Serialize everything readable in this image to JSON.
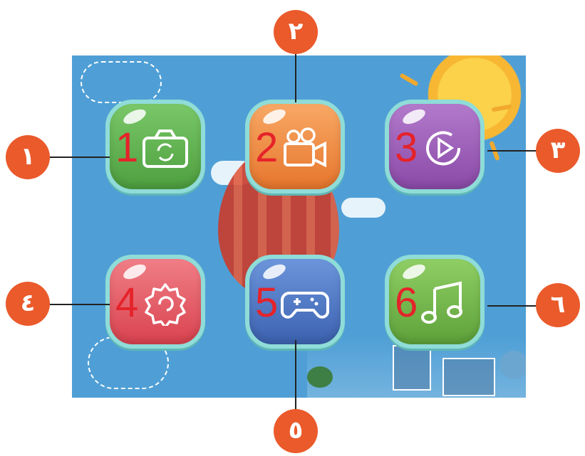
{
  "tiles": [
    {
      "id": "camera",
      "number": "1",
      "icon": "camera-icon",
      "color": "#5fb450"
    },
    {
      "id": "video",
      "number": "2",
      "icon": "video-camera-icon",
      "color": "#f08a3c"
    },
    {
      "id": "playback",
      "number": "3",
      "icon": "playback-icon",
      "color": "#9a5bb5"
    },
    {
      "id": "settings",
      "number": "4",
      "icon": "gear-icon",
      "color": "#e55a64"
    },
    {
      "id": "games",
      "number": "5",
      "icon": "gamepad-icon",
      "color": "#4a73c4"
    },
    {
      "id": "music",
      "number": "6",
      "icon": "music-note-icon",
      "color": "#72b64a"
    }
  ],
  "callouts": [
    {
      "id": "1",
      "label": "١"
    },
    {
      "id": "2",
      "label": "٢"
    },
    {
      "id": "3",
      "label": "٣"
    },
    {
      "id": "4",
      "label": "٤"
    },
    {
      "id": "5",
      "label": "٥"
    },
    {
      "id": "6",
      "label": "٦"
    }
  ],
  "colors": {
    "screen_bg": "#4f9fd6",
    "callout": "#ea5a2b",
    "tile_border": "#8fdcd8",
    "number": "#e5232a"
  }
}
